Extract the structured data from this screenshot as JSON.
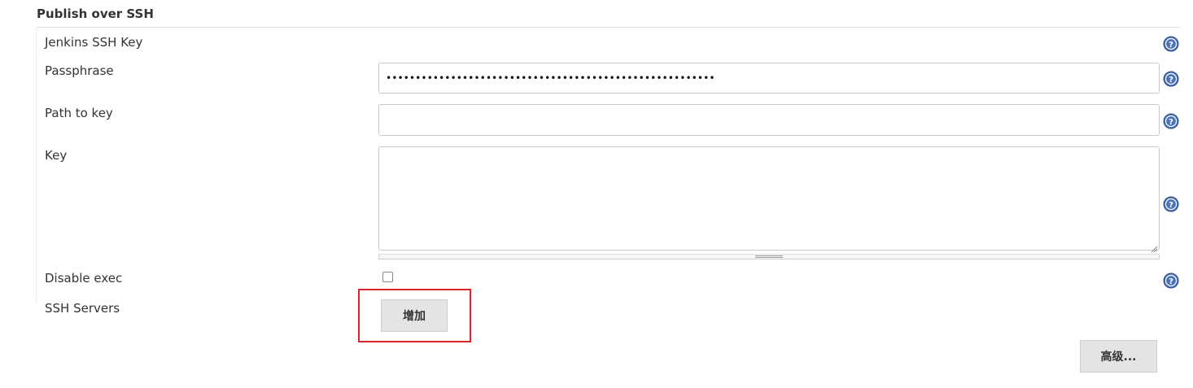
{
  "section": {
    "title": "Publish over SSH"
  },
  "fields": {
    "jenkins_ssh_key_label": "Jenkins SSH Key",
    "passphrase_label": "Passphrase",
    "passphrase_value": "••••••••••••••••••••••••••••••••••••••••••••••••••••••••",
    "path_to_key_label": "Path to key",
    "path_to_key_value": "",
    "key_label": "Key",
    "key_value": "",
    "disable_exec_label": "Disable exec",
    "disable_exec_checked": false,
    "ssh_servers_label": "SSH Servers"
  },
  "buttons": {
    "add_label": "增加",
    "advanced_label": "高级..."
  },
  "icons": {
    "help": "help-icon"
  },
  "colors": {
    "help_icon": "#4a72b8",
    "highlight": "#d9262c",
    "button_bg": "#e4e4e4"
  }
}
